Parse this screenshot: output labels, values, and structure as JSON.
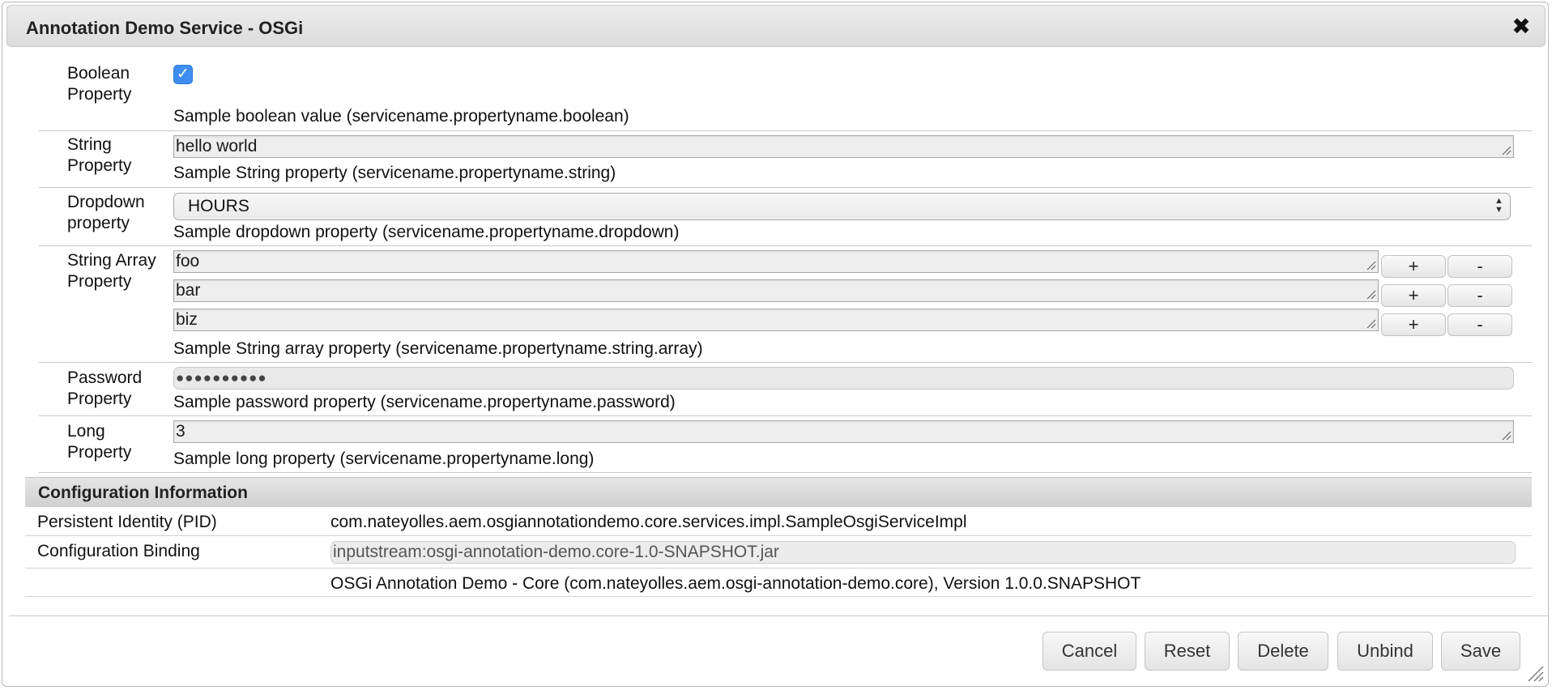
{
  "dialog": {
    "title": "Annotation Demo Service - OSGi",
    "close_icon": "close-icon"
  },
  "properties": {
    "boolean": {
      "label": "Boolean Property",
      "checked": true,
      "description": "Sample boolean value (servicename.propertyname.boolean)"
    },
    "string": {
      "label": "String Property",
      "value": "hello world",
      "description": "Sample String property (servicename.propertyname.string)"
    },
    "dropdown": {
      "label": "Dropdown property",
      "selected": "HOURS",
      "description": "Sample dropdown property (servicename.propertyname.dropdown)"
    },
    "string_array": {
      "label": "String Array Property",
      "values": [
        "foo",
        "bar",
        "biz"
      ],
      "add_label": "+",
      "remove_label": "-",
      "description": "Sample String array property (servicename.propertyname.string.array)"
    },
    "password": {
      "label": "Password Property",
      "value": "●●●●●●●●●●",
      "description": "Sample password property (servicename.propertyname.password)"
    },
    "long": {
      "label": "Long Property",
      "value": "3",
      "description": "Sample long property (servicename.propertyname.long)"
    }
  },
  "config_info": {
    "header": "Configuration Information",
    "pid_label": "Persistent Identity (PID)",
    "pid_value": "com.nateyolles.aem.osgiannotationdemo.core.services.impl.SampleOsgiServiceImpl",
    "binding_label": "Configuration Binding",
    "binding_value": "inputstream:osgi-annotation-demo.core-1.0-SNAPSHOT.jar",
    "bundle_value": "OSGi Annotation Demo - Core (com.nateyolles.aem.osgi-annotation-demo.core), Version 1.0.0.SNAPSHOT"
  },
  "buttons": {
    "cancel": "Cancel",
    "reset": "Reset",
    "delete": "Delete",
    "unbind": "Unbind",
    "save": "Save"
  },
  "colors": {
    "accent": "#3d8ef0",
    "header_bg": "#dcdcdc"
  }
}
